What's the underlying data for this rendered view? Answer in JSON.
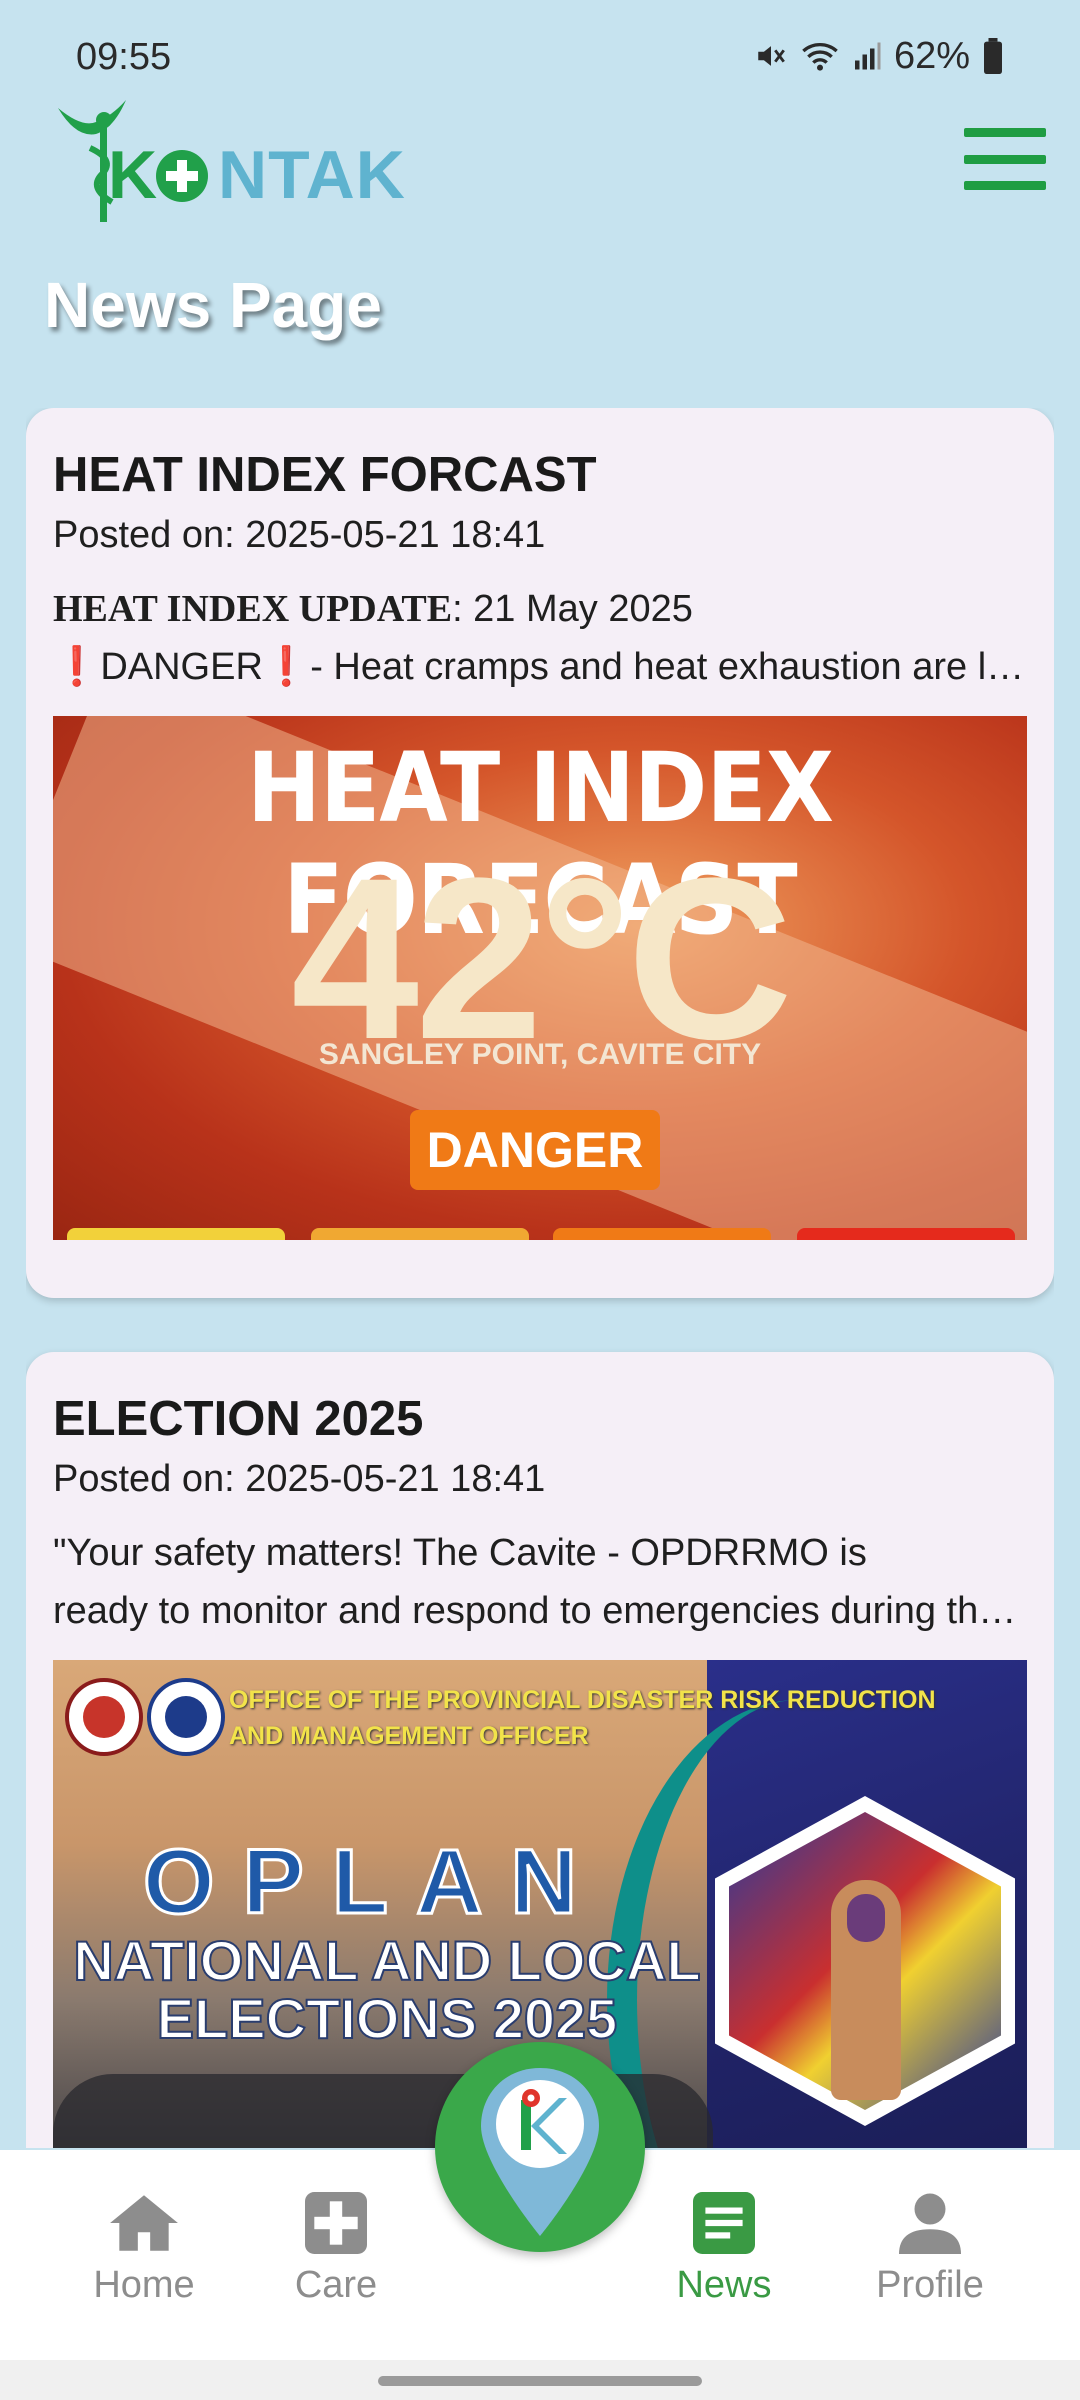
{
  "status_bar": {
    "time": "09:55",
    "battery": "62%",
    "icons": [
      "mute-icon",
      "wifi-icon",
      "signal-icon",
      "battery-icon"
    ]
  },
  "app": {
    "logo_text": "KONTAK",
    "brand_green": "#1f9d43",
    "brand_blue": "#5fb3cf"
  },
  "page": {
    "title": "News Page",
    "background": "#c6e3ef"
  },
  "news": [
    {
      "title": "HEAT INDEX FORCAST",
      "posted": "Posted on: 2025-05-21 18:41",
      "body_line1_strong": "HEAT INDEX UPDATE",
      "body_line1_rest": ": 21 May 2025",
      "body_line2": "❗DANGER❗- Heat cramps and heat exhaustion are likely; heat stroke is probable with continued exposure.",
      "image": {
        "headline": "HEAT INDEX FORECAST",
        "temperature": "42°C",
        "location": "SANGLEY POINT, CAVITE CITY",
        "level": "DANGER"
      }
    },
    {
      "title": "ELECTION 2025",
      "posted": "Posted on: 2025-05-21 18:41",
      "body_line1": "\"Your safety matters! The Cavite - OPDRRMO is",
      "body_line2": "ready to monitor and respond to emergencies during the elections.",
      "image": {
        "office_line1": "OFFICE OF THE PROVINCIAL DISASTER RISK REDUCTION",
        "office_line2": "AND MANAGEMENT OFFICER",
        "oplan": "OPLAN",
        "event_line1": "NATIONAL AND LOCAL",
        "event_line2": "ELECTIONS 2025"
      }
    }
  ],
  "bottom_nav": {
    "items": [
      {
        "label": "Home",
        "icon": "home-icon",
        "active": false
      },
      {
        "label": "Care",
        "icon": "medical-cross-icon",
        "active": false
      },
      {
        "label": "News",
        "icon": "news-icon",
        "active": true
      },
      {
        "label": "Profile",
        "icon": "profile-icon",
        "active": false
      }
    ],
    "fab_icon": "location-pin-logo-icon",
    "active_color": "#3a9a44",
    "inactive_color": "#8d8d8d"
  }
}
